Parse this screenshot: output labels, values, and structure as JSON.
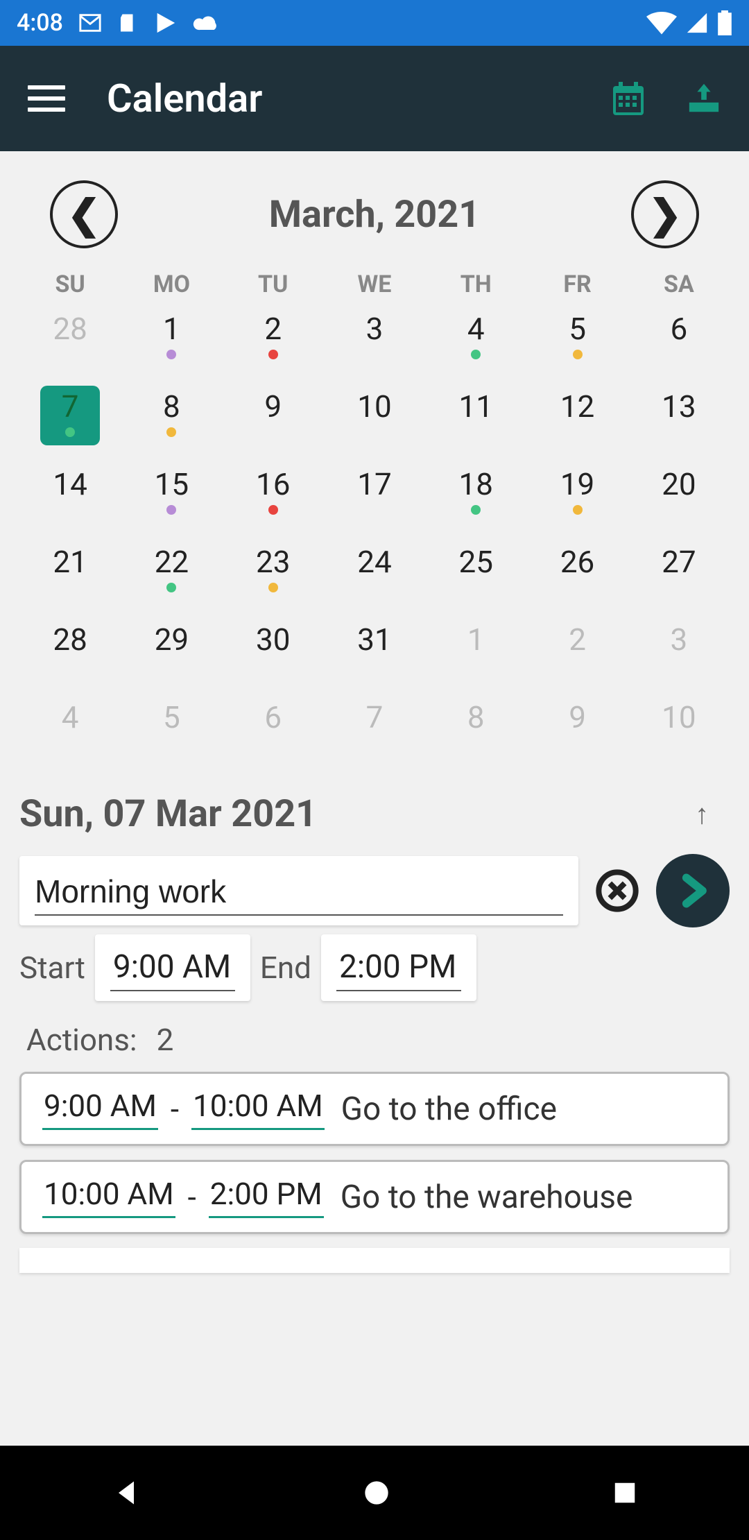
{
  "status": {
    "time": "4:08"
  },
  "appbar": {
    "title": "Calendar"
  },
  "calendar": {
    "month_label": "March, 2021",
    "dow": [
      "SU",
      "MO",
      "TU",
      "WE",
      "TH",
      "FR",
      "SA"
    ],
    "selected_day": 7,
    "weeks": [
      [
        {
          "n": "28",
          "out": true
        },
        {
          "n": "1",
          "dot": "purple"
        },
        {
          "n": "2",
          "dot": "red"
        },
        {
          "n": "3"
        },
        {
          "n": "4",
          "dot": "green"
        },
        {
          "n": "5",
          "dot": "amber"
        },
        {
          "n": "6"
        }
      ],
      [
        {
          "n": "7",
          "dot": "green",
          "selected": true
        },
        {
          "n": "8",
          "dot": "amber"
        },
        {
          "n": "9"
        },
        {
          "n": "10"
        },
        {
          "n": "11"
        },
        {
          "n": "12"
        },
        {
          "n": "13"
        }
      ],
      [
        {
          "n": "14"
        },
        {
          "n": "15",
          "dot": "purple"
        },
        {
          "n": "16",
          "dot": "red"
        },
        {
          "n": "17"
        },
        {
          "n": "18",
          "dot": "green"
        },
        {
          "n": "19",
          "dot": "amber"
        },
        {
          "n": "20"
        }
      ],
      [
        {
          "n": "21"
        },
        {
          "n": "22",
          "dot": "green"
        },
        {
          "n": "23",
          "dot": "amber"
        },
        {
          "n": "24"
        },
        {
          "n": "25"
        },
        {
          "n": "26"
        },
        {
          "n": "27"
        }
      ],
      [
        {
          "n": "28"
        },
        {
          "n": "29"
        },
        {
          "n": "30"
        },
        {
          "n": "31"
        },
        {
          "n": "1",
          "out": true
        },
        {
          "n": "2",
          "out": true
        },
        {
          "n": "3",
          "out": true
        }
      ],
      [
        {
          "n": "4",
          "out": true
        },
        {
          "n": "5",
          "out": true
        },
        {
          "n": "6",
          "out": true
        },
        {
          "n": "7",
          "out": true
        },
        {
          "n": "8",
          "out": true
        },
        {
          "n": "9",
          "out": true
        },
        {
          "n": "10",
          "out": true
        }
      ]
    ]
  },
  "selected": {
    "label": "Sun, 07 Mar 2021",
    "event_title": "Morning work",
    "start_label": "Start",
    "start_time": "9:00 AM",
    "end_label": "End",
    "end_time": "2:00 PM"
  },
  "actions": {
    "label": "Actions:",
    "count": "2",
    "items": [
      {
        "from": "9:00 AM",
        "to": "10:00 AM",
        "desc": "Go to the office"
      },
      {
        "from": "10:00 AM",
        "to": "2:00 PM",
        "desc": "Go to the warehouse"
      }
    ]
  }
}
